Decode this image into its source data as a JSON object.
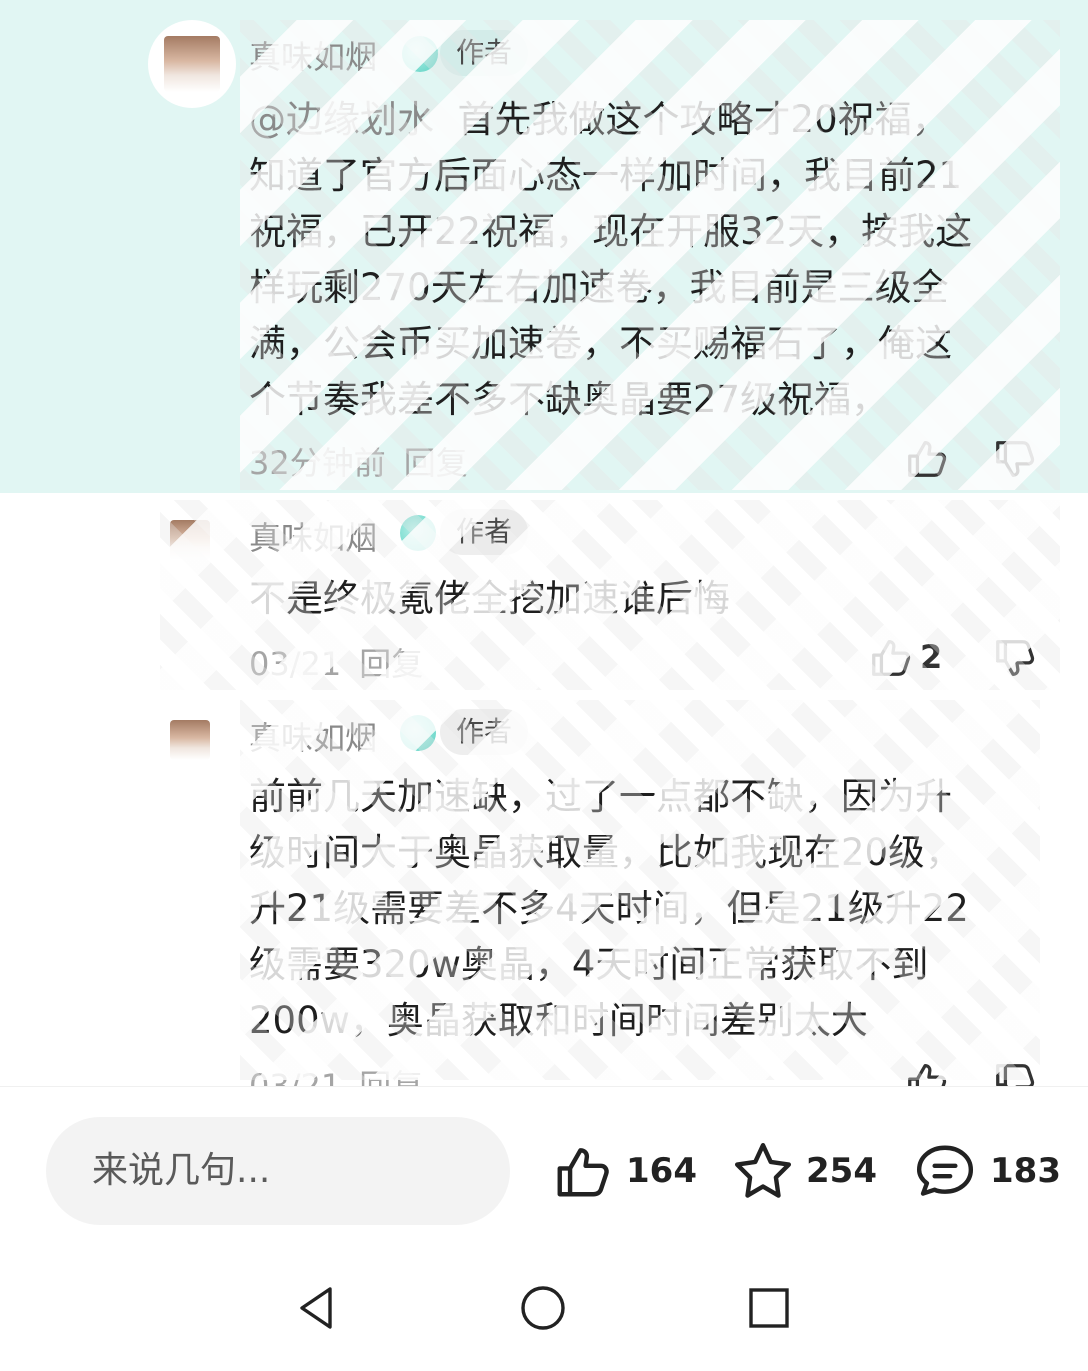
{
  "comments": [
    {
      "author": "真味如烟",
      "author_tag": "作者",
      "mention": "@边缘划水",
      "text_lines": [
        "首先我做这个攻略才20祝福，",
        "知道了官方后面心态一样加时间，我目前21",
        "祝福，已开22祝福，现在开服32天，按我这",
        "样玩剩270天左右加速卷，我目前是三级全",
        "满，公会币买加速卷，不买赐福石了，俺这",
        "个节奏我差不多不缺奥晶要27级祝福，"
      ],
      "time": "32分钟前",
      "reply_label": "回复",
      "like_count": "",
      "icons": {
        "like": "thumbs-up-icon",
        "dislike": "thumbs-down-icon"
      }
    },
    {
      "author": "真味如烟",
      "author_tag": "作者",
      "text": "不是终极氪佬全挖加速谁后悔",
      "time": "03/21",
      "reply_label": "回复",
      "like_count": "2",
      "icons": {
        "like": "thumbs-up-icon",
        "dislike": "thumbs-down-icon"
      }
    },
    {
      "author": "真味如烟",
      "author_tag": "作者",
      "text_lines": [
        "前前几天加速缺，过了一点都不缺，因为升",
        "级时间大于奥晶获取量，比如我现在20级，",
        "升21级需要差不多4天时间，但是21级升22",
        "级需要320w奥晶，4天时间正常获取不到",
        "200w，奥晶获取和时间时间差别太大"
      ],
      "time": "03/21",
      "reply_label": "回复",
      "icons": {
        "like": "thumbs-up-icon",
        "dislike": "thumbs-down-icon"
      }
    }
  ],
  "bottom_bar": {
    "input_placeholder": "来说几句...",
    "like_count": "164",
    "favorite_count": "254",
    "comment_count": "183",
    "icons": {
      "like": "thumbs-up-icon",
      "favorite": "star-icon",
      "comment": "comment-bubble-icon"
    }
  },
  "nav": {
    "icons": {
      "back": "back-triangle-icon",
      "home": "home-circle-icon",
      "recents": "recents-square-icon"
    }
  },
  "colors": {
    "highlight_bg": "#e1f6f3",
    "meta_gray": "#a5a5a5",
    "name_gray": "#8a8a8a",
    "text": "#1f1f1f"
  }
}
